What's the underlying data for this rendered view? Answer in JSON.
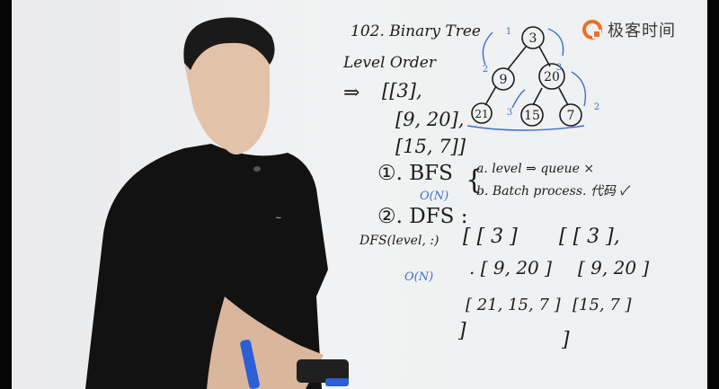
{
  "logo": {
    "text": "极客时间",
    "icon": "geektime-logo-icon",
    "accent": "#f06f22"
  },
  "board": {
    "problem_title": "102. Binary Tree",
    "problem_subtitle": "Level Order",
    "arrow": "⇒",
    "result": [
      "[[3],",
      "[9, 20],",
      "[15, 7]]"
    ],
    "tree": {
      "root": "3",
      "level1": [
        "9",
        "20"
      ],
      "level2": [
        "21",
        "15",
        "7"
      ],
      "counters": [
        "1",
        "2",
        "3",
        "3",
        "2"
      ]
    },
    "approach1": {
      "label": "①. BFS",
      "complexity": "O(N)",
      "options": [
        "a. level ⇒ queue ×",
        "b. Batch process. 代码 ✓"
      ]
    },
    "approach2": {
      "label": "②. DFS :",
      "call": "DFS(level, :)",
      "complexity": "O(N)"
    },
    "dfs_steps": {
      "left": [
        "[ [ 3 ]",
        ". [ 9, 20 ]",
        "[ 21, 15, 7 ]",
        "]"
      ],
      "right": [
        "[ [ 3 ],",
        "[ 9, 20 ]",
        "[15, 7 ]",
        "]"
      ]
    }
  },
  "colors": {
    "ink": "#1c1c1c",
    "blue_ink": "#3f6fd0",
    "shirt": "#121212"
  }
}
